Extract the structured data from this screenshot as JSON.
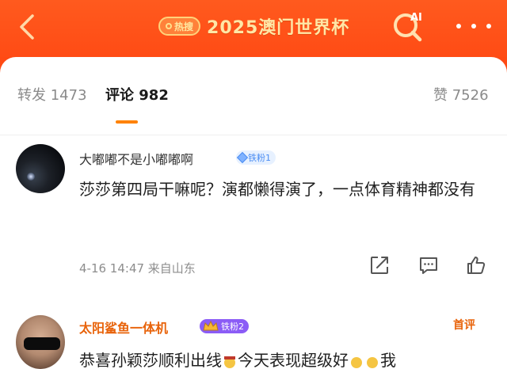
{
  "header": {
    "hot_label": "热搜",
    "title": "2025澳门世界杯",
    "icons": [
      "back-icon",
      "ai-search-icon",
      "more-icon"
    ],
    "colors": {
      "background": "#ff4a14",
      "title": "#ffe7a6"
    }
  },
  "tabs": {
    "reposts": "转发 1473",
    "comments": "评论 982",
    "likes": "赞 7526",
    "active": "comments",
    "accent": "#ff8200"
  },
  "comments": [
    {
      "username": "大嘟嘟不是小嘟嘟啊",
      "badge": "铁粉1",
      "text": "莎莎第四局干嘛呢？演都懒得演了，一点体育精神都没有",
      "meta": "4-16 14:47 来自山东",
      "icons": [
        "share-icon",
        "comment-icon",
        "like-icon"
      ]
    },
    {
      "username": "太阳鲨鱼一体机",
      "badge": "铁粉2",
      "label": "首评",
      "text_part1": "恭喜孙颖莎顺利出线",
      "text_part2": "今天表现超级好",
      "text_part3": "我"
    }
  ]
}
